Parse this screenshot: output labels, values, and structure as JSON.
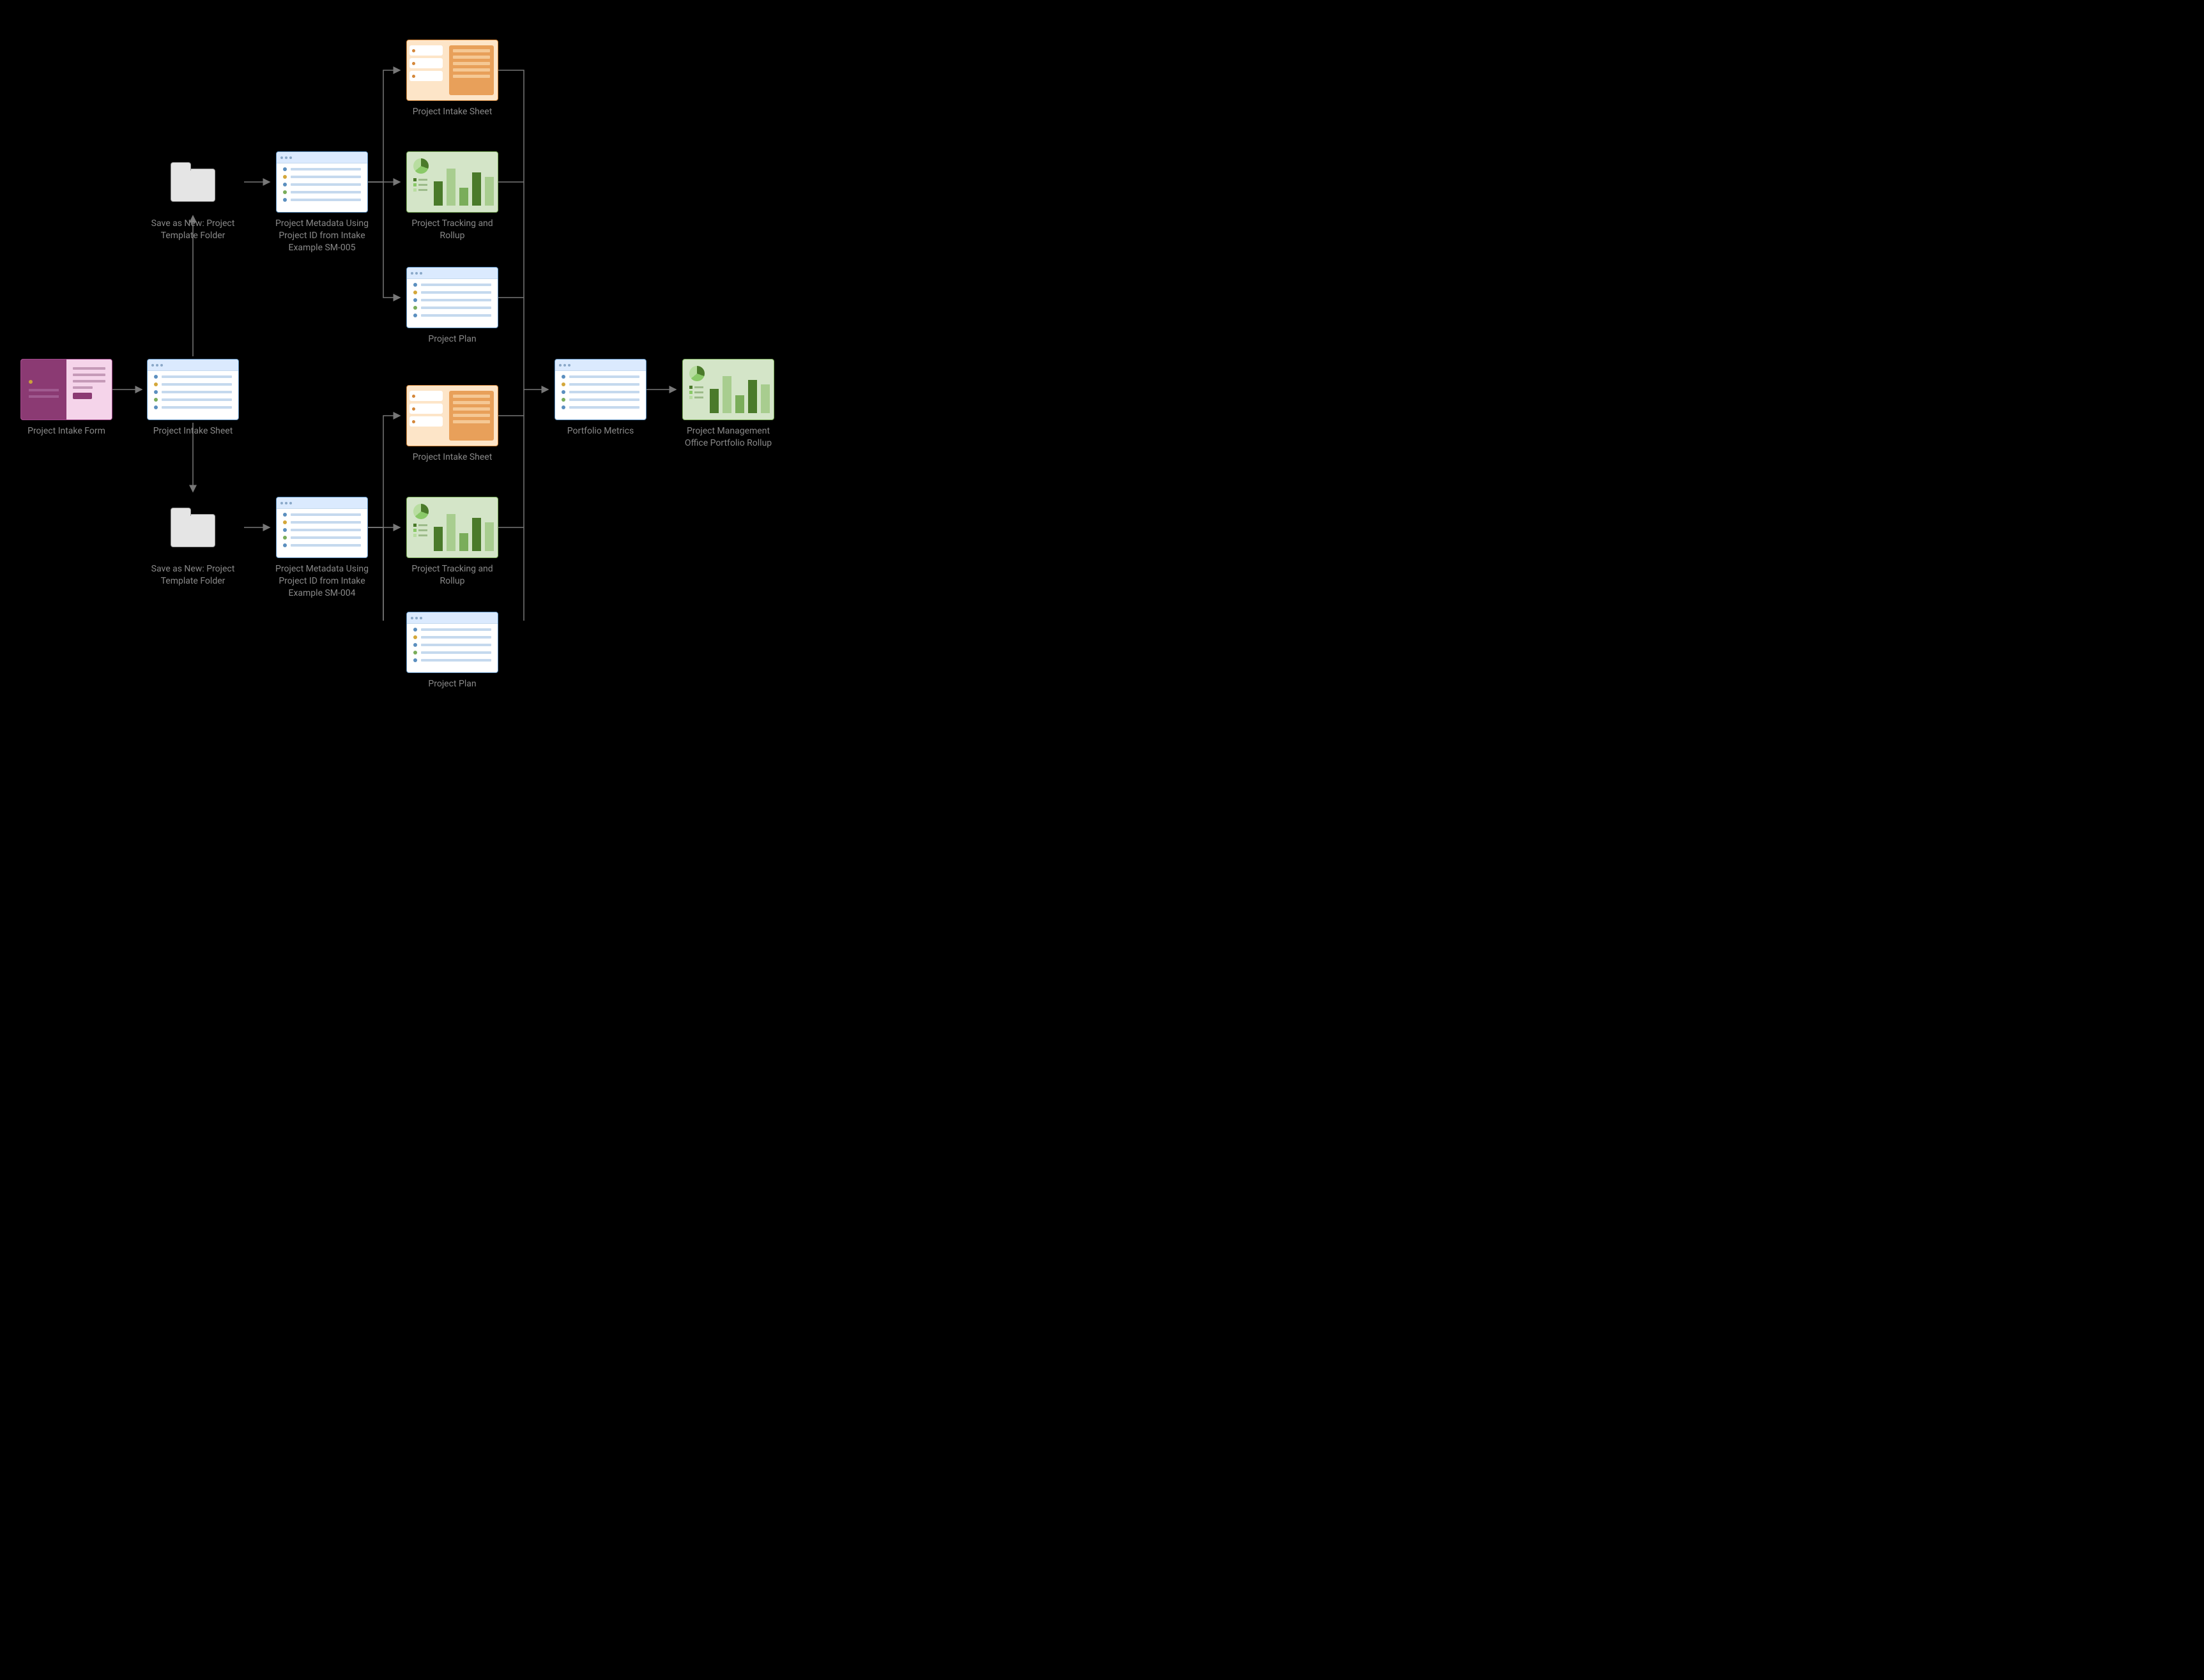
{
  "nodes": {
    "form": {
      "label": "Project Intake Form"
    },
    "intake_sheet": {
      "label": "Project Intake Sheet"
    },
    "folder_top": {
      "label": "Save as New: Project Template Folder"
    },
    "folder_bot": {
      "label": "Save as New: Project Template Folder"
    },
    "metadata_top": {
      "label": "Project Metadata Using Project ID from Intake Example SM-005"
    },
    "metadata_bot": {
      "label": "Project Metadata Using Project ID from Intake Example SM-004"
    },
    "pis_top": {
      "label": "Project Intake Sheet"
    },
    "ptr_top": {
      "label": "Project Tracking and Rollup"
    },
    "plan_top": {
      "label": "Project Plan"
    },
    "pis_bot": {
      "label": "Project Intake Sheet"
    },
    "ptr_bot": {
      "label": "Project Tracking and Rollup"
    },
    "plan_bot": {
      "label": "Project Plan"
    },
    "portfolio": {
      "label": "Portfolio Metrics"
    },
    "pmo": {
      "label": "Project Management Office Portfolio Rollup"
    }
  }
}
